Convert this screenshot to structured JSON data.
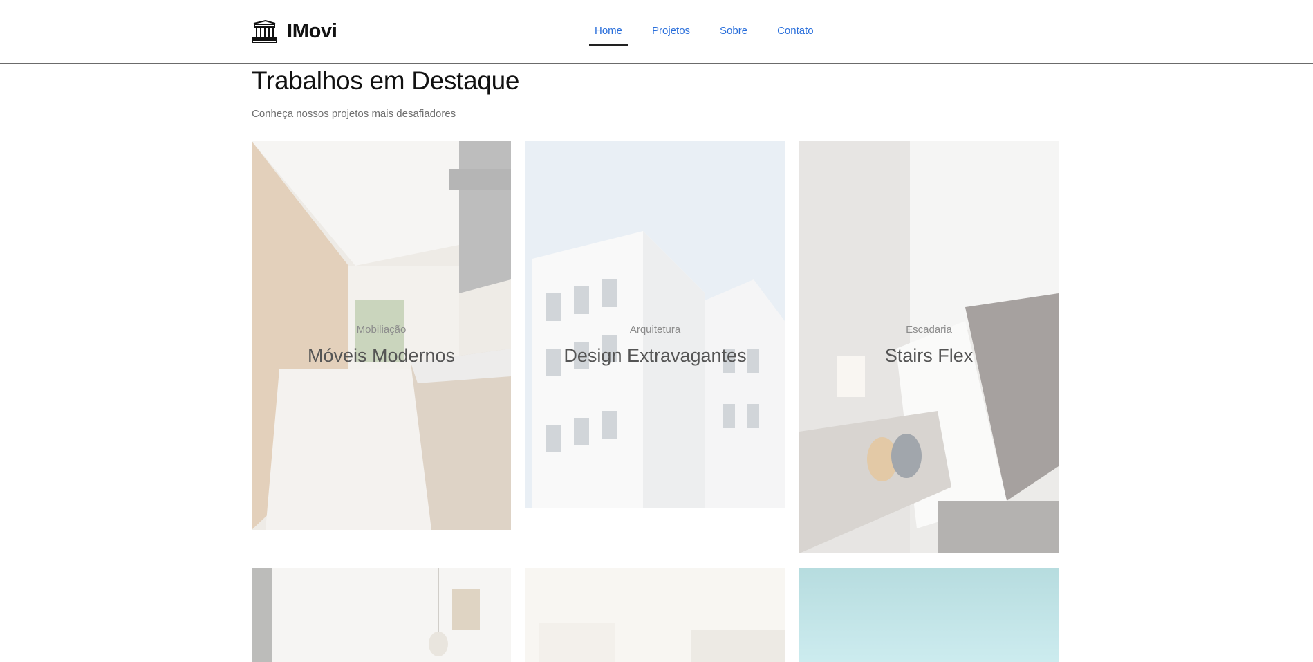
{
  "brand": {
    "name": "IMovi",
    "icon": "building-icon"
  },
  "nav": {
    "items": [
      {
        "label": "Home",
        "active": true
      },
      {
        "label": "Projetos",
        "active": false
      },
      {
        "label": "Sobre",
        "active": false
      },
      {
        "label": "Contato",
        "active": false
      }
    ]
  },
  "section": {
    "title": "Trabalhos em Destaque",
    "subtitle": "Conheça nossos projetos mais desafiadores"
  },
  "projects": [
    {
      "category": "Mobiliação",
      "name": "Móveis Modernos"
    },
    {
      "category": "Arquitetura",
      "name": "Design Extravagantes"
    },
    {
      "category": "Escadaria",
      "name": "Stairs Flex"
    }
  ],
  "colors": {
    "accent": "#2a6fdb",
    "divider": "#6b6b6b"
  }
}
